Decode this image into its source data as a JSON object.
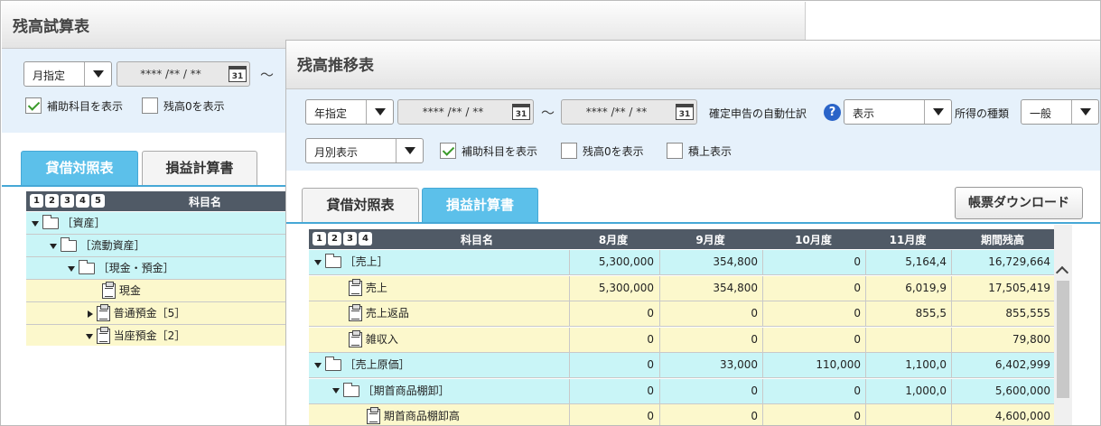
{
  "back": {
    "title": "残高試算表",
    "period_type": "月指定",
    "date_from": "**** /** / **",
    "tilde": "～",
    "cal_icon": "31",
    "show_sub": "補助科目を表示",
    "show_zero": "残高0を表示",
    "tabs": [
      "貸借対照表",
      "損益計算書"
    ],
    "levels": [
      "1",
      "2",
      "3",
      "4",
      "5"
    ],
    "col_name": "科目名",
    "rows": [
      {
        "label": "［資産］"
      },
      {
        "label": "［流動資産］"
      },
      {
        "label": "［現金・預金］"
      },
      {
        "label": "現金"
      },
      {
        "label": "普通預金［5］"
      },
      {
        "label": "当座預金［2］"
      }
    ]
  },
  "front": {
    "title": "残高推移表",
    "period_type": "年指定",
    "date_from": "**** /** / **",
    "date_to": "**** /** / **",
    "tilde": "～",
    "cal_icon": "31",
    "auto_entry_label": "確定申告の自動仕訳",
    "help": "?",
    "auto_entry_value": "表示",
    "income_type_label": "所得の種類",
    "income_type_value": "一般",
    "display_mode": "月別表示",
    "show_sub": "補助科目を表示",
    "show_zero": "残高0を表示",
    "show_cumulative": "積上表示",
    "tabs": [
      "貸借対照表",
      "損益計算書"
    ],
    "download": "帳票ダウンロード",
    "levels": [
      "1",
      "2",
      "3",
      "4"
    ],
    "columns": [
      "科目名",
      "8月度",
      "9月度",
      "10月度",
      "11月度",
      "期間残高"
    ],
    "rows": [
      {
        "label": "［売上］",
        "v": [
          "5,300,000",
          "354,800",
          "0",
          "5,164,4",
          "16,729,664"
        ]
      },
      {
        "label": "売上",
        "v": [
          "5,300,000",
          "354,800",
          "0",
          "6,019,9",
          "17,505,419"
        ]
      },
      {
        "label": "売上返品",
        "v": [
          "0",
          "0",
          "0",
          "855,5",
          "855,555"
        ]
      },
      {
        "label": "雑収入",
        "v": [
          "0",
          "0",
          "0",
          "",
          "79,800"
        ]
      },
      {
        "label": "［売上原価］",
        "v": [
          "0",
          "33,000",
          "110,000",
          "1,100,0",
          "6,402,999"
        ]
      },
      {
        "label": "［期首商品棚卸］",
        "v": [
          "0",
          "0",
          "0",
          "1,000,0",
          "5,600,000"
        ]
      },
      {
        "label": "期首商品棚卸高",
        "v": [
          "0",
          "0",
          "0",
          "",
          "4,600,000"
        ]
      }
    ]
  }
}
